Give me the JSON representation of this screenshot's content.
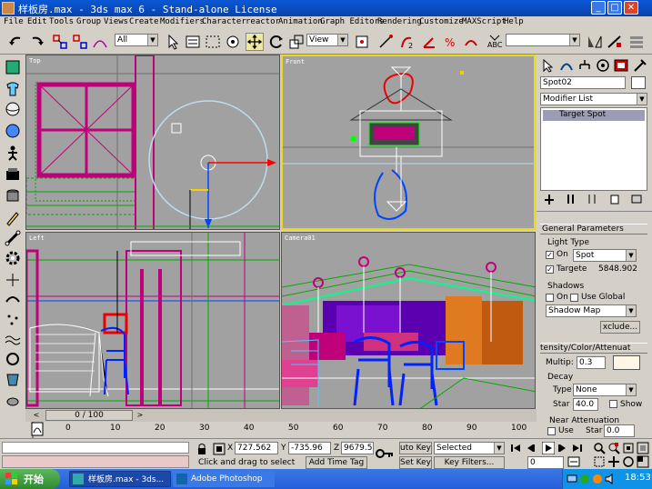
{
  "window": {
    "title": "样板房.max - 3ds max 6 - Stand-alone License"
  },
  "menu": [
    "File",
    "Edit",
    "Tools",
    "Group",
    "Views",
    "Create",
    "Modifiers",
    "Character",
    "reactor",
    "Animation",
    "Graph Editors",
    "Rendering",
    "Customize",
    "MAXScript",
    "Help"
  ],
  "toolbar": {
    "selection_filter": "All",
    "ref_coord": "View"
  },
  "viewports": {
    "top": "Top",
    "front": "Front",
    "left": "Left",
    "camera": "Camera01"
  },
  "command_panel": {
    "object_name": "Spot02",
    "modifier_list": "Modifier List",
    "stack_item": "Target Spot",
    "general_params": {
      "title": "General Parameters",
      "light_type_label": "Light Type",
      "on_label": "On",
      "type_value": "Spot",
      "targeted_label": "Targete",
      "target_distance": "5848.902",
      "shadows_label": "Shadows",
      "shadows_on_label": "On",
      "use_global_label": "Use Global",
      "shadow_type": "Shadow Map",
      "exclude_label": "xclude..."
    },
    "intensity": {
      "title": "tensity/Color/Attenuat",
      "multiplier_label": "Multip:",
      "multiplier_value": "0.3",
      "decay_label": "Decay",
      "decay_type_label": "Type",
      "decay_type_value": "None",
      "start_label": "Star",
      "start_value": "40.0",
      "show_label": "Show",
      "near_atten_label": "Near Attenuation",
      "use_label": "Use",
      "near_start_label": "Star",
      "near_start_value": "0.0"
    }
  },
  "timeline": {
    "frame_display": "0 / 100",
    "ticks": [
      "0",
      "10",
      "20",
      "30",
      "40",
      "50",
      "60",
      "70",
      "80",
      "90",
      "100"
    ]
  },
  "status": {
    "x_label": "X",
    "x_value": "727.562",
    "y_label": "Y",
    "y_value": "-735.96",
    "z_label": "Z",
    "z_value": "9679.5",
    "prompt": "Click and drag to select",
    "add_time_tag": "Add Time Tag",
    "auto_key": "uto Key",
    "set_key": "Set Key",
    "key_filter_value": "Selected",
    "key_filters_btn": "Key Filters...",
    "frame_value": "0"
  },
  "taskbar": {
    "start": "开始",
    "tasks": [
      "样板房.max - 3ds...",
      "Adobe Photoshop"
    ],
    "clock": "18:53"
  }
}
